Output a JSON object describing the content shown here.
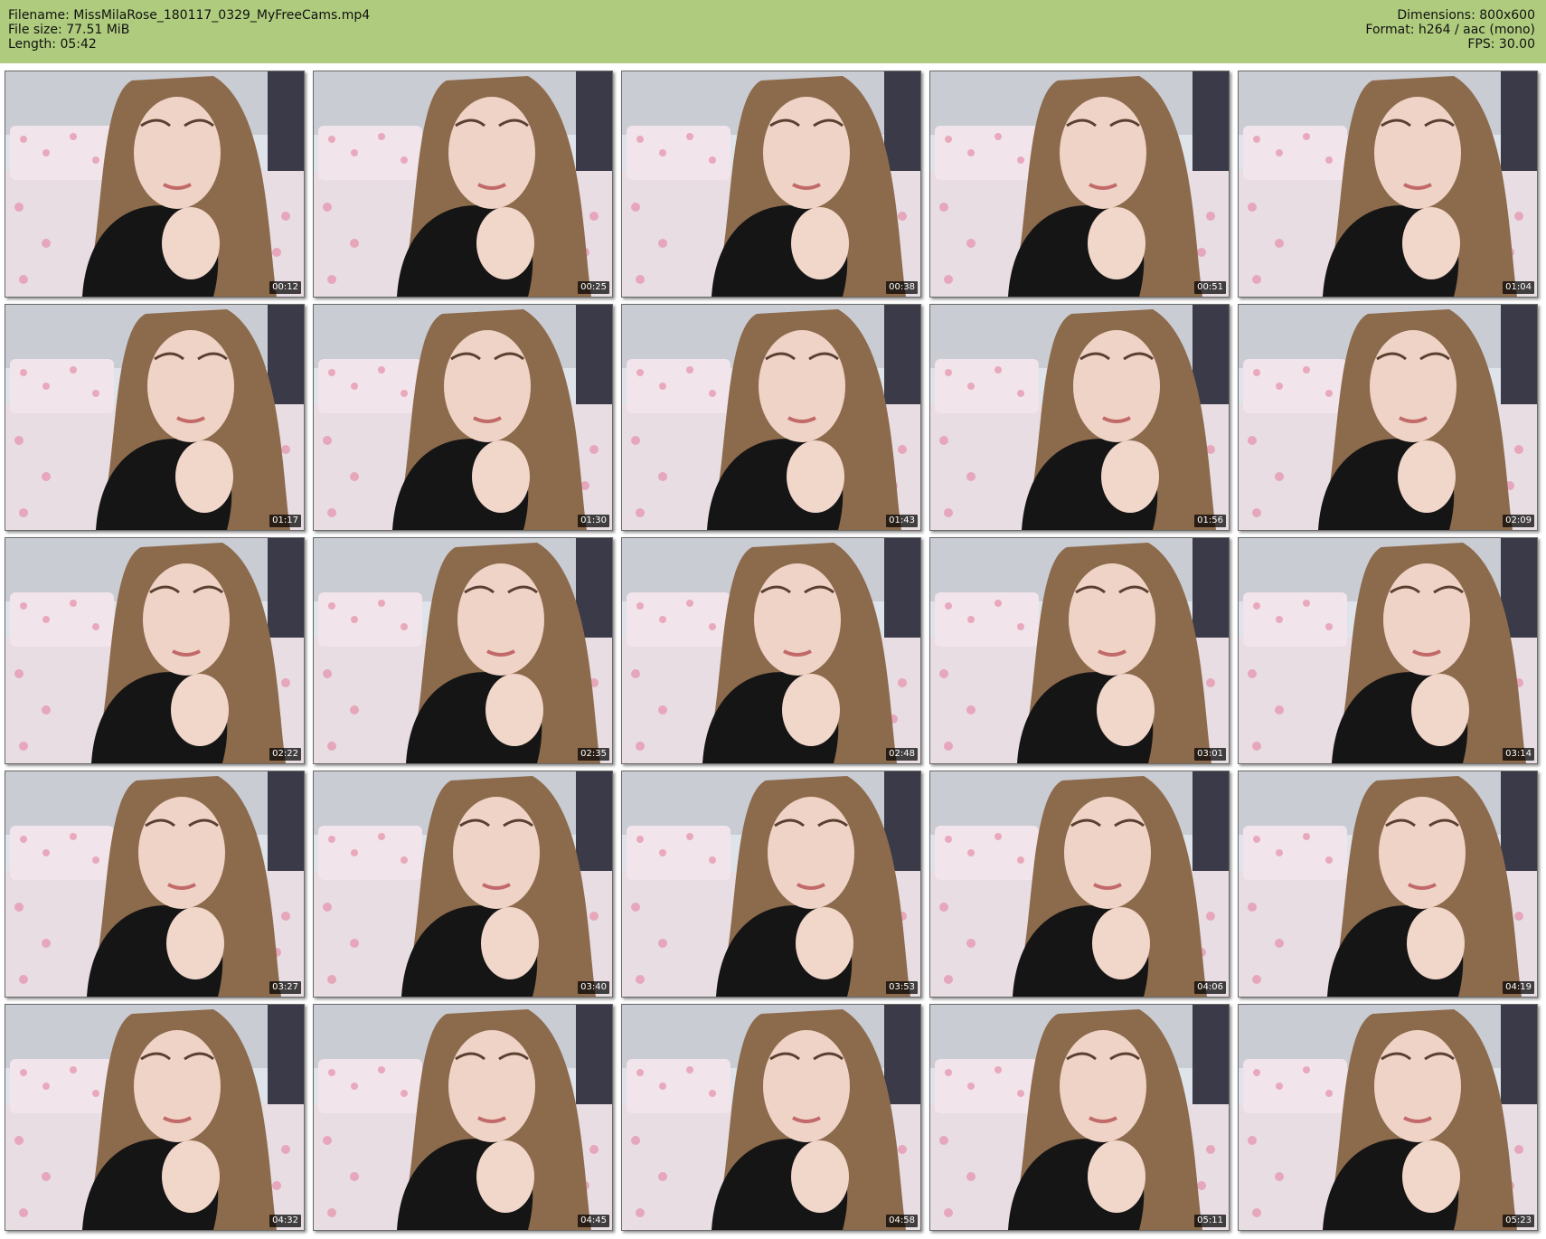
{
  "header": {
    "filename_line": "Filename: MissMilaRose_180117_0329_MyFreeCams.mp4",
    "filesize_line": "File size: 77.51 MiB",
    "length_line": "Length: 05:42",
    "dimensions_line": "Dimensions: 800x600",
    "format_line": "Format: h264 / aac (mono)",
    "fps_line": "FPS: 30.00"
  },
  "colors": {
    "header_bg": "#afcc7e",
    "timestamp_bg": "#000000",
    "timestamp_text": "#ffffff"
  },
  "thumbnails": [
    {
      "timestamp": "00:12"
    },
    {
      "timestamp": "00:25"
    },
    {
      "timestamp": "00:38"
    },
    {
      "timestamp": "00:51"
    },
    {
      "timestamp": "01:04"
    },
    {
      "timestamp": "01:17"
    },
    {
      "timestamp": "01:30"
    },
    {
      "timestamp": "01:43"
    },
    {
      "timestamp": "01:56"
    },
    {
      "timestamp": "02:09"
    },
    {
      "timestamp": "02:22"
    },
    {
      "timestamp": "02:35"
    },
    {
      "timestamp": "02:48"
    },
    {
      "timestamp": "03:01"
    },
    {
      "timestamp": "03:14"
    },
    {
      "timestamp": "03:27"
    },
    {
      "timestamp": "03:40"
    },
    {
      "timestamp": "03:53"
    },
    {
      "timestamp": "04:06"
    },
    {
      "timestamp": "04:19"
    },
    {
      "timestamp": "04:32"
    },
    {
      "timestamp": "04:45"
    },
    {
      "timestamp": "04:58"
    },
    {
      "timestamp": "05:11"
    },
    {
      "timestamp": "05:23"
    }
  ]
}
